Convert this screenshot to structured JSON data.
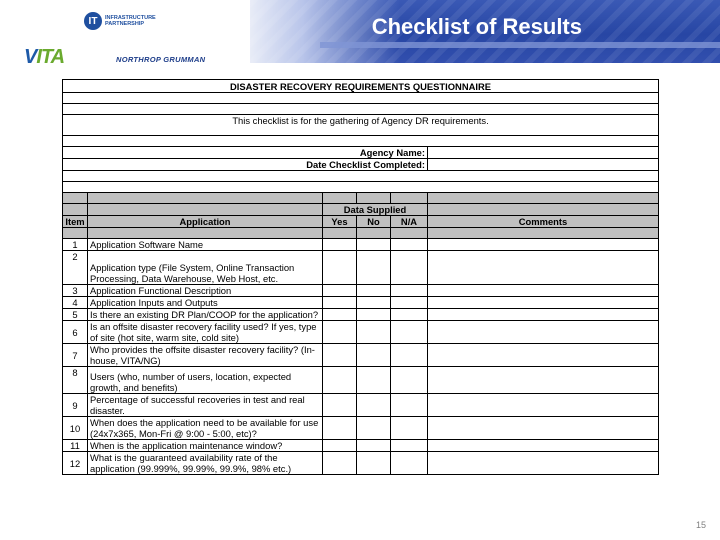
{
  "header": {
    "title": "Checklist of Results",
    "logo_itp_letters": "IT",
    "logo_itp_text": "INFRASTRUCTURE\nPARTNERSHIP",
    "logo_vita": "VITA",
    "logo_ng": "NORTHROP GRUMMAN"
  },
  "questionnaire": {
    "heading": "DISASTER RECOVERY REQUIREMENTS QUESTIONNAIRE",
    "intro": "This checklist is for the gathering of Agency DR requirements.",
    "agency_name_label": "Agency Name:",
    "date_label": "Date Checklist Completed:",
    "data_supplied_label": "Data Supplied",
    "columns": {
      "item": "Item",
      "application": "Application",
      "yes": "Yes",
      "no": "No",
      "na": "N/A",
      "comments": "Comments"
    },
    "items": [
      {
        "num": "1",
        "text": "Application Software Name"
      },
      {
        "num": "2",
        "text": "Application type (File System, Online Transaction Processing, Data Warehouse, Web Host, etc."
      },
      {
        "num": "3",
        "text": "Application Functional Description"
      },
      {
        "num": "4",
        "text": "Application Inputs and Outputs"
      },
      {
        "num": "5",
        "text": "Is there an existing DR Plan/COOP for the application?"
      },
      {
        "num": "6",
        "text": "Is an offsite disaster recovery facility used?  If yes, type of site (hot site, warm site, cold site)"
      },
      {
        "num": "7",
        "text": "Who provides the offsite disaster recovery facility? (In-house, VITA/NG)"
      },
      {
        "num": "8",
        "text": "Users (who, number of users, location, expected growth, and benefits)"
      },
      {
        "num": "9",
        "text": "Percentage of successful recoveries in test and real disaster."
      },
      {
        "num": "10",
        "text": "When does the application need to be available for use (24x7x365, Mon-Fri @ 9:00 - 5:00, etc)?"
      },
      {
        "num": "11",
        "text": "When is the application maintenance window?"
      },
      {
        "num": "12",
        "text": "What is the guaranteed availability rate of the application (99.999%, 99.99%, 99.9%, 98% etc.)"
      }
    ]
  },
  "footer": {
    "page_number": "15"
  }
}
